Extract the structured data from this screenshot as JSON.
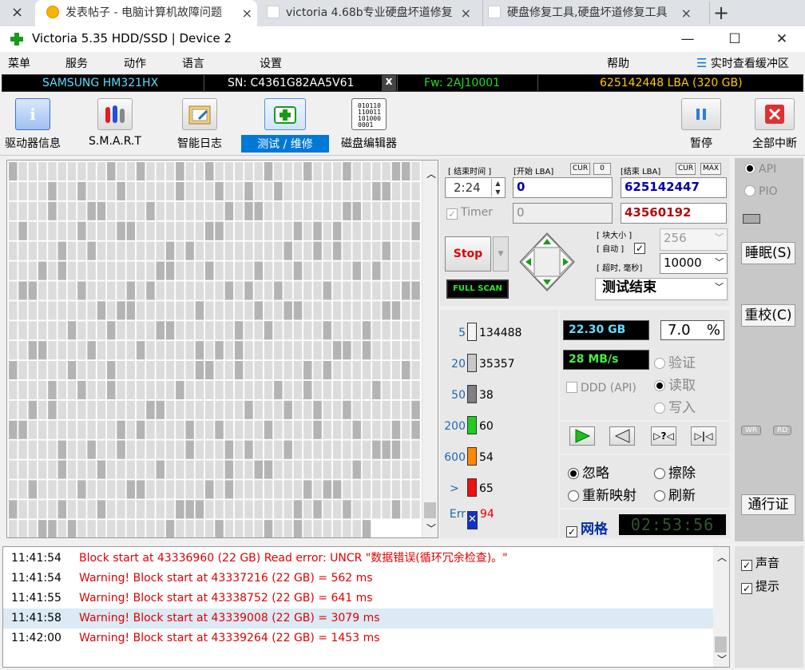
{
  "browser": {
    "tabs": [
      {
        "label": "发表帖子 - 电脑计算机故障问题",
        "active": true
      },
      {
        "label": "victoria 4.68b专业硬盘坏道修复",
        "active": false
      },
      {
        "label": "硬盘修复工具,硬盘坏道修复工具",
        "active": false
      }
    ],
    "close_glyph": "×",
    "new_tab_glyph": "+"
  },
  "window": {
    "title": "Victoria 5.35 HDD/SSD | Device 2",
    "minimize": "—",
    "maximize": "☐",
    "close": "✕"
  },
  "menu": {
    "items": [
      "菜单",
      "服务",
      "动作",
      "语言",
      "设置"
    ],
    "help": "帮助",
    "realtime": "实时查看缓冲区"
  },
  "drive": {
    "model": "SAMSUNG HM321HX",
    "serial": "SN: C4361G82AA5V61",
    "x_label": "x",
    "firmware": "Fw: 2AJ10001",
    "capacity": "625142448 LBA (320 GB)"
  },
  "toolbar": {
    "items": [
      {
        "label": "驱动器信息",
        "icon": "info-icon"
      },
      {
        "label": "S.M.A.R.T",
        "icon": "smart-icon"
      },
      {
        "label": "智能日志",
        "icon": "log-icon"
      },
      {
        "label": "测试 / 维修",
        "icon": "first-aid-icon",
        "active": true
      },
      {
        "label": "磁盘编辑器",
        "icon": "hex-editor-icon"
      }
    ],
    "pause": "暂停",
    "abort_all": "全部中断"
  },
  "test": {
    "end_time_label": "[ 结束时间 ]",
    "start_lba_label": "[开始 LBA]",
    "cur_label": "CUR",
    "start_cur_value": "0",
    "end_lba_label": "[结束 LBA]",
    "max_label": "MAX",
    "time_value": "2:24",
    "start_lba": "0",
    "end_lba": "625142447",
    "timer_label": "Timer",
    "timer_value": "0",
    "current_lba": "43560192",
    "stop_label": "Stop",
    "fullscan_label": "FULL SCAN",
    "block_size_label": "[ 块大小 ]",
    "auto_label": "[ 自动 ]",
    "block_size": "256",
    "timeout_label": "[ 超时, 毫秒]",
    "timeout": "10000",
    "status": "测试结束"
  },
  "legend": [
    {
      "label": "5",
      "count": "134488",
      "color": "#f4f4f4"
    },
    {
      "label": "20",
      "count": "35357",
      "color": "#c8c8c8"
    },
    {
      "label": "50",
      "count": "38",
      "color": "#808080"
    },
    {
      "label": "200",
      "count": "60",
      "color": "#22cc22"
    },
    {
      "label": "600",
      "count": "54",
      "color": "#ff8800"
    },
    {
      "label": ">",
      "count": "65",
      "color": "#ee1111"
    },
    {
      "label": "Err",
      "count": "94",
      "color": "#1030d0"
    }
  ],
  "stats": {
    "processed": "22.30 GB",
    "percent": "7.0",
    "percent_sign": "%",
    "speed": "28 MB/s",
    "ddd_label": "DDD (API)",
    "verify": "验证",
    "read": "读取",
    "write": "写入"
  },
  "repair": {
    "ignore": "忽略",
    "erase": "擦除",
    "remap": "重新映射",
    "refresh": "刷新",
    "grid_label": "网格",
    "grid_timer": "02:53:56"
  },
  "side": {
    "api": "API",
    "pio": "PIO",
    "sleep": "睡眠(S)",
    "recalibrate": "重校(C)",
    "wr": "WR",
    "rd": "RD",
    "passport": "通行证",
    "sound": "声音",
    "hints": "提示"
  },
  "log": [
    {
      "time": "11:41:54",
      "message": "Block start at 43336960 (22 GB) Read error: UNCR \"数据错误(循环冗余检查)。\""
    },
    {
      "time": "11:41:54",
      "message": "Warning! Block start at 43337216 (22 GB)  = 562 ms"
    },
    {
      "time": "11:41:55",
      "message": "Warning! Block start at 43338752 (22 GB)  = 641 ms"
    },
    {
      "time": "11:41:58",
      "message": "Warning! Block start at 43339008 (22 GB)  = 3079 ms",
      "highlight": true
    },
    {
      "time": "11:42:00",
      "message": "Warning! Block start at 43339264 (22 GB)  = 1453 ms"
    }
  ],
  "colors": {
    "accent": "#0078d7",
    "active_tab": "#0078d7",
    "error_red": "#e00000",
    "info_cyan": "#55e0ff",
    "info_green": "#22dd22",
    "info_yellow": "#ffcc00",
    "stat_cyan": "#66ddff",
    "stat_green": "#44ee44",
    "map_light": "#dcdcdc",
    "map_dark": "#b4b4b4",
    "log_highlight": "#dbeaf5"
  }
}
